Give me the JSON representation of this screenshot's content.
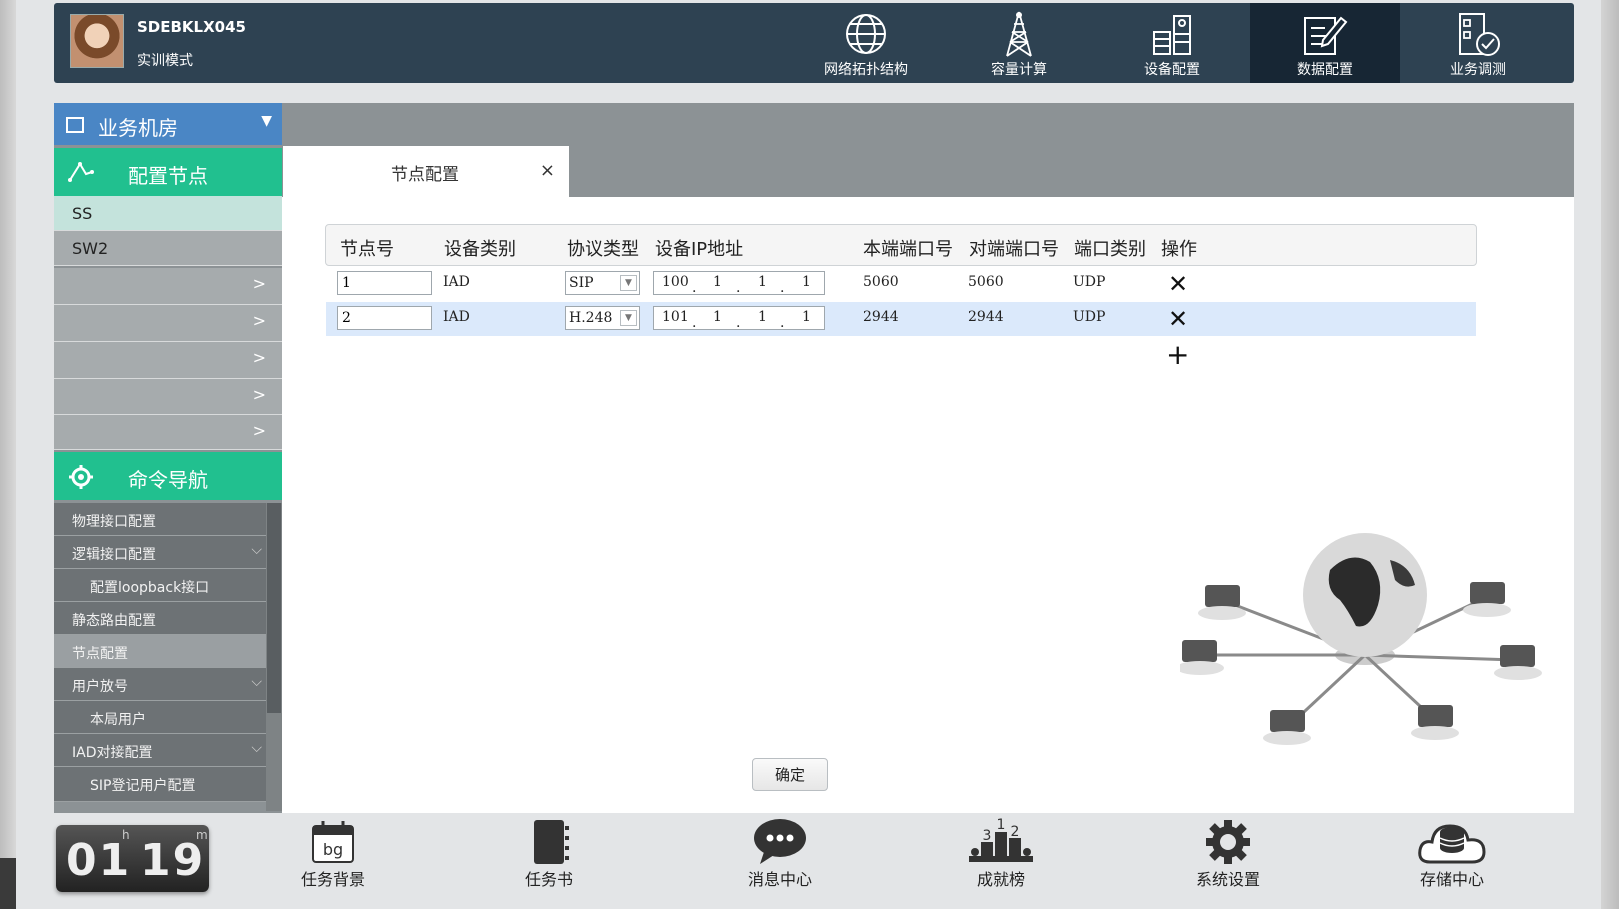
{
  "user": {
    "name": "SDEBKLX045",
    "mode": "实训模式"
  },
  "top_nav": [
    {
      "label": "网络拓扑结构",
      "icon": "globe-network-icon",
      "active": false
    },
    {
      "label": "容量计算",
      "icon": "tower-icon",
      "active": false
    },
    {
      "label": "设备配置",
      "icon": "server-rack-icon",
      "active": false
    },
    {
      "label": "数据配置",
      "icon": "edit-document-icon",
      "active": true
    },
    {
      "label": "业务调测",
      "icon": "checklist-icon",
      "active": false
    }
  ],
  "sidebar": {
    "room_label": "业务机房",
    "config_nodes_title": "配置节点",
    "nodes": [
      {
        "label": "SS",
        "selected": true
      },
      {
        "label": "SW2",
        "selected": false
      },
      {
        "label": "",
        "selected": false
      },
      {
        "label": "",
        "selected": false
      },
      {
        "label": "",
        "selected": false
      },
      {
        "label": "",
        "selected": false
      },
      {
        "label": "",
        "selected": false
      }
    ],
    "command_nav_title": "命令导航",
    "commands": [
      {
        "label": "物理接口配置",
        "sub": false,
        "expand": false,
        "selected": false
      },
      {
        "label": "逻辑接口配置",
        "sub": false,
        "expand": true,
        "selected": false
      },
      {
        "label": "配置loopback接口",
        "sub": true,
        "expand": false,
        "selected": false
      },
      {
        "label": "静态路由配置",
        "sub": false,
        "expand": false,
        "selected": false
      },
      {
        "label": "节点配置",
        "sub": false,
        "expand": false,
        "selected": true
      },
      {
        "label": "用户放号",
        "sub": false,
        "expand": true,
        "selected": false
      },
      {
        "label": "本局用户",
        "sub": true,
        "expand": false,
        "selected": false
      },
      {
        "label": "IAD对接配置",
        "sub": false,
        "expand": true,
        "selected": false
      },
      {
        "label": "SIP登记用户配置",
        "sub": true,
        "expand": false,
        "selected": false
      }
    ]
  },
  "tab": {
    "label": "节点配置",
    "close": "×"
  },
  "table": {
    "headers": [
      "节点号",
      "设备类别",
      "协议类型",
      "设备IP地址",
      "本端端口号",
      "对端端口号",
      "端口类别",
      "操作"
    ],
    "rows": [
      {
        "node_id": "1",
        "device_type": "IAD",
        "protocol": "SIP",
        "ip": [
          "100",
          "1",
          "1",
          "1"
        ],
        "local_port": "5060",
        "remote_port": "5060",
        "port_type": "UDP",
        "action": "✕"
      },
      {
        "node_id": "2",
        "device_type": "IAD",
        "protocol": "H.248",
        "ip": [
          "101",
          "1",
          "1",
          "1"
        ],
        "local_port": "2944",
        "remote_port": "2944",
        "port_type": "UDP",
        "action": "✕"
      }
    ],
    "add_symbol": "+"
  },
  "confirm_label": "确定",
  "timer": {
    "hours": "01",
    "minutes": "19",
    "h_unit": "h",
    "m_unit": "m"
  },
  "bottom_nav": [
    {
      "label": "任务背景",
      "icon": "calendar-bg-icon",
      "badge": "bg"
    },
    {
      "label": "任务书",
      "icon": "notebook-icon"
    },
    {
      "label": "消息中心",
      "icon": "chat-bubble-icon"
    },
    {
      "label": "成就榜",
      "icon": "podium-icon",
      "ranks": [
        "3",
        "1",
        "2"
      ]
    },
    {
      "label": "系统设置",
      "icon": "gear-icon"
    },
    {
      "label": "存储中心",
      "icon": "cloud-storage-icon"
    }
  ],
  "colors": {
    "topbar": "#2e4252",
    "active_nav": "#172634",
    "green_header": "#21c08f",
    "blue_header": "#4a86c5",
    "row_highlight": "#dbe9fb"
  }
}
